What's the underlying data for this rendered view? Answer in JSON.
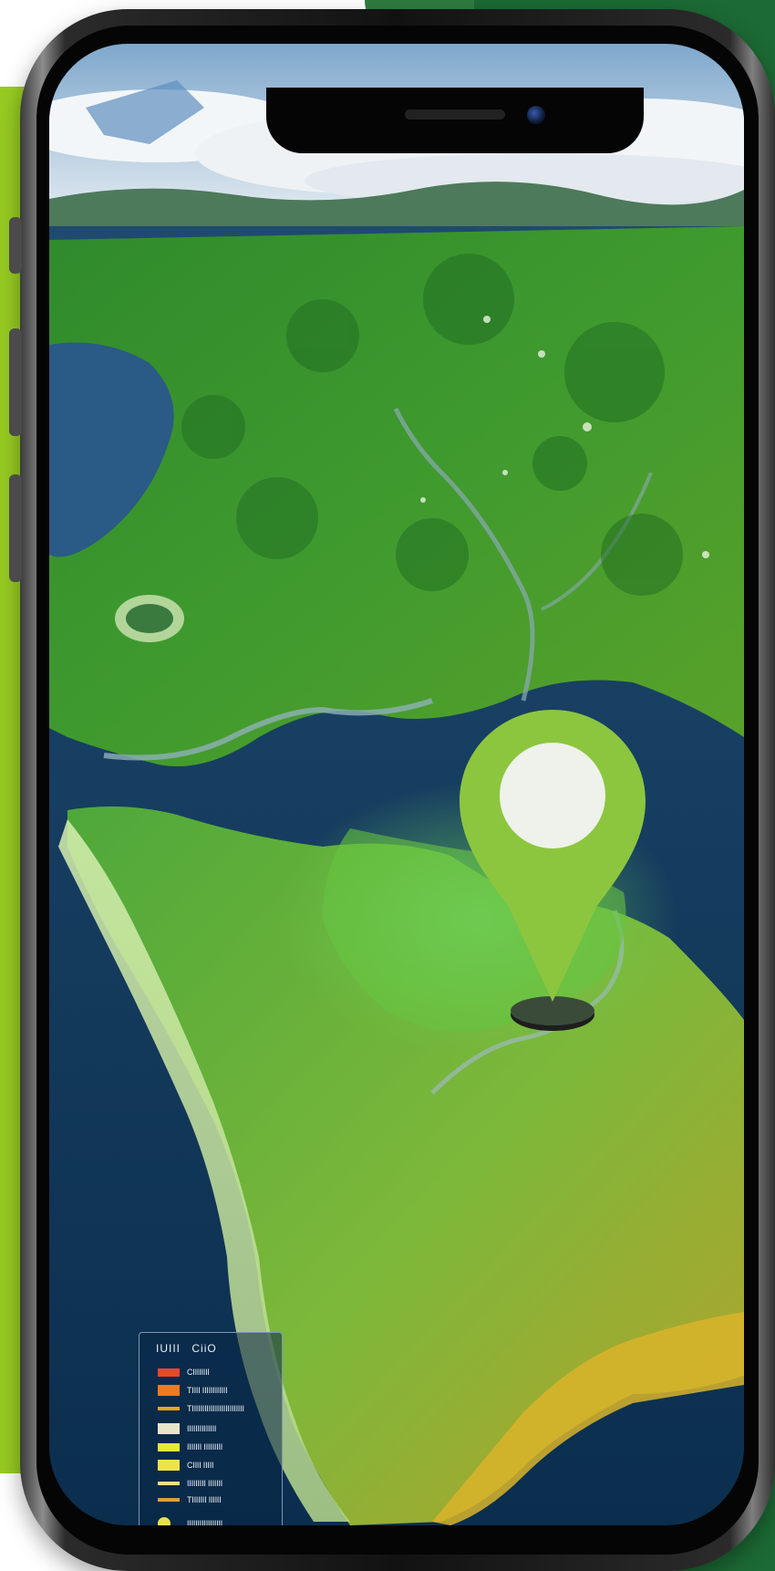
{
  "legend": {
    "title_left": "IUIII",
    "title_right": "CiiO",
    "items": [
      {
        "label": "CIIIIIIII",
        "color": "#e9462c",
        "shape": "bar"
      },
      {
        "label": "TIIII IIIIIIIIIIII",
        "color": "#f27a1a",
        "shape": "block"
      },
      {
        "label": "TIIIIIIIIIIIIIIIIIIIIIIIII",
        "color": "#f2a51a",
        "shape": "line"
      },
      {
        "label": "IIIIIIIIIIIIII",
        "color": "#e8e6c8",
        "shape": "block"
      },
      {
        "label": "IIIIIII IIIIIIIII",
        "color": "#e6e83a",
        "shape": "bar"
      },
      {
        "label": "CIIII IIIII",
        "color": "#f0e24a",
        "shape": "block"
      },
      {
        "label": "IIIIIIIII IIIIIII",
        "color": "#efe28a",
        "shape": "line"
      },
      {
        "label": "TIIIIIII IIIIII",
        "color": "#d7a23a",
        "shape": "line"
      },
      {
        "label": "IIIIIIIIIIIIIIIII",
        "color": "#e8e14a",
        "shape": "dot"
      }
    ]
  },
  "map": {
    "marker": "location-pin-icon",
    "marker_color": "#8cc63f"
  },
  "colors": {
    "accent_lime": "#97cc22",
    "accent_dark_green": "#1c6a34"
  }
}
